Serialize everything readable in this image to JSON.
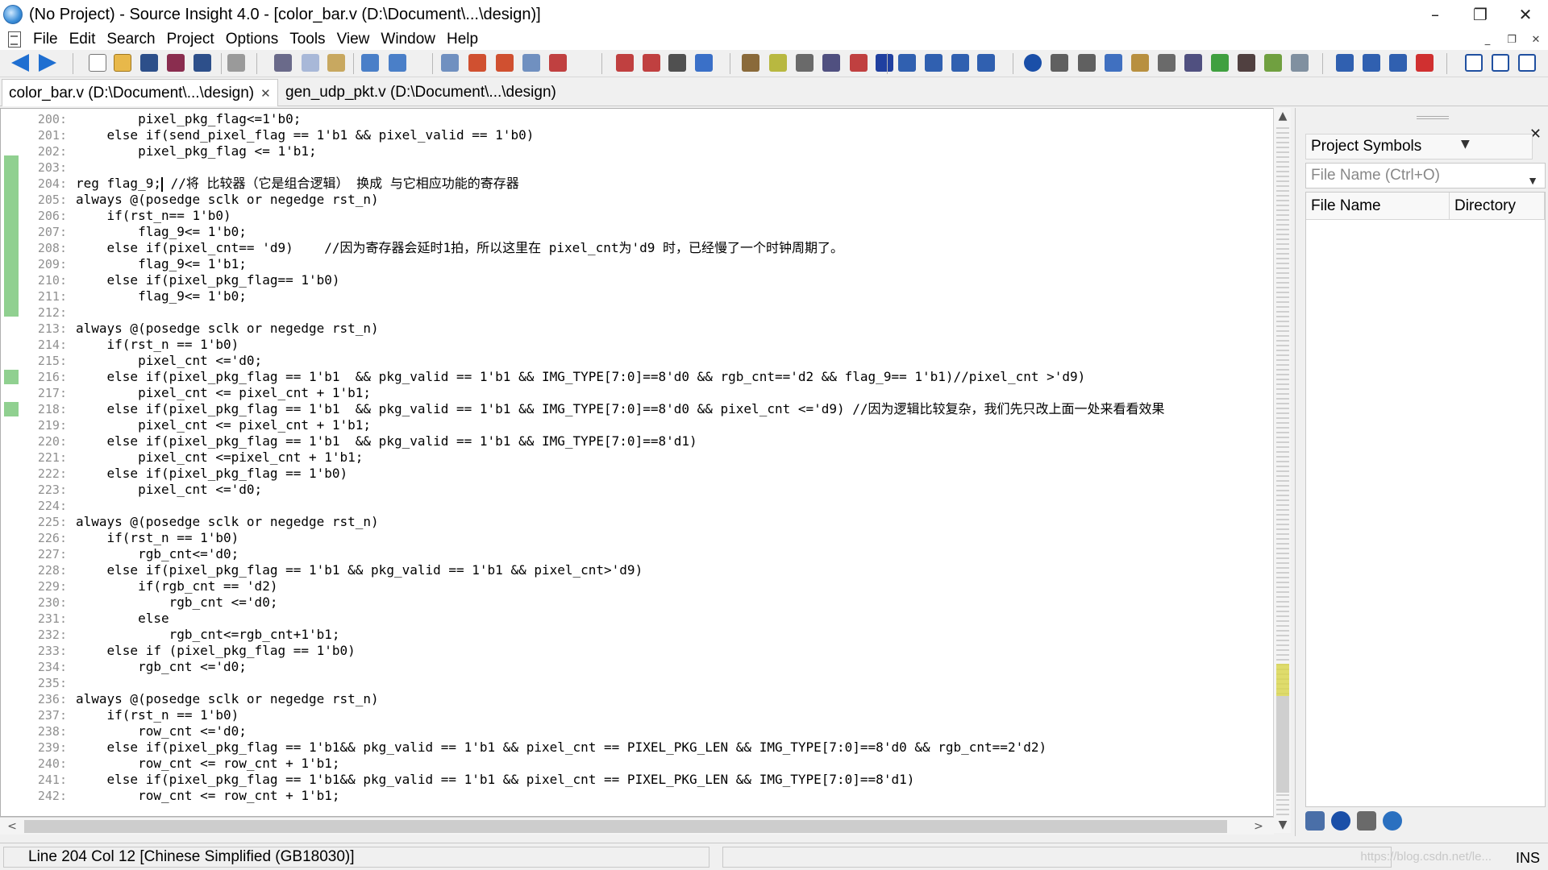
{
  "window": {
    "title": "(No Project) - Source Insight 4.0 - [color_bar.v (D:\\Document\\...\\design)]"
  },
  "menu": [
    "File",
    "Edit",
    "Search",
    "Project",
    "Options",
    "Tools",
    "View",
    "Window",
    "Help"
  ],
  "window_controls": {
    "minimize": "–",
    "restore": "❐",
    "close": "✕"
  },
  "mdi_controls": {
    "minimize": "_",
    "restore": "❐",
    "close": "✕"
  },
  "tabs": [
    {
      "label": "color_bar.v (D:\\Document\\...\\design)",
      "active": true,
      "close": "✕"
    },
    {
      "label": "gen_udp_pkt.v (D:\\Document\\...\\design)",
      "active": false
    }
  ],
  "editor": {
    "lines": [
      {
        "n": "200:",
        "code": "        pixel_pkg_flag<=1'b0;"
      },
      {
        "n": "201:",
        "code": "    else if(send_pixel_flag == 1'b1 && pixel_valid == 1'b0)"
      },
      {
        "n": "202:",
        "code": "        pixel_pkg_flag <= 1'b1;"
      },
      {
        "n": "203:",
        "code": ""
      },
      {
        "n": "204:",
        "code": "reg flag_9;",
        "after_caret": " //将 比较器（它是组合逻辑） 换成 与它相应功能的寄存器",
        "caret": true
      },
      {
        "n": "205:",
        "code": "always @(posedge sclk or negedge rst_n)"
      },
      {
        "n": "206:",
        "code": "    if(rst_n== 1'b0)"
      },
      {
        "n": "207:",
        "code": "        flag_9<= 1'b0;"
      },
      {
        "n": "208:",
        "code": "    else if(pixel_cnt== 'd9)    //因为寄存器会延时1拍，所以这里在 pixel_cnt为'd9 时，已经慢了一个时钟周期了。"
      },
      {
        "n": "209:",
        "code": "        flag_9<= 1'b1;"
      },
      {
        "n": "210:",
        "code": "    else if(pixel_pkg_flag== 1'b0)"
      },
      {
        "n": "211:",
        "code": "        flag_9<= 1'b0;"
      },
      {
        "n": "212:",
        "code": ""
      },
      {
        "n": "213:",
        "code": "always @(posedge sclk or negedge rst_n)"
      },
      {
        "n": "214:",
        "code": "    if(rst_n == 1'b0)"
      },
      {
        "n": "215:",
        "code": "        pixel_cnt <='d0;"
      },
      {
        "n": "216:",
        "code": "    else if(pixel_pkg_flag == 1'b1  && pkg_valid == 1'b1 && IMG_TYPE[7:0]==8'd0 && rgb_cnt=='d2 && flag_9== 1'b1)//pixel_cnt >'d9)"
      },
      {
        "n": "217:",
        "code": "        pixel_cnt <= pixel_cnt + 1'b1;"
      },
      {
        "n": "218:",
        "code": "    else if(pixel_pkg_flag == 1'b1  && pkg_valid == 1'b1 && IMG_TYPE[7:0]==8'd0 && pixel_cnt <='d9) //因为逻辑比较复杂，我们先只改上面一处来看看效果"
      },
      {
        "n": "219:",
        "code": "        pixel_cnt <= pixel_cnt + 1'b1;"
      },
      {
        "n": "220:",
        "code": "    else if(pixel_pkg_flag == 1'b1  && pkg_valid == 1'b1 && IMG_TYPE[7:0]==8'd1)"
      },
      {
        "n": "221:",
        "code": "        pixel_cnt <=pixel_cnt + 1'b1;"
      },
      {
        "n": "222:",
        "code": "    else if(pixel_pkg_flag == 1'b0)"
      },
      {
        "n": "223:",
        "code": "        pixel_cnt <='d0;"
      },
      {
        "n": "224:",
        "code": ""
      },
      {
        "n": "225:",
        "code": "always @(posedge sclk or negedge rst_n)"
      },
      {
        "n": "226:",
        "code": "    if(rst_n == 1'b0)"
      },
      {
        "n": "227:",
        "code": "        rgb_cnt<='d0;"
      },
      {
        "n": "228:",
        "code": "    else if(pixel_pkg_flag == 1'b1 && pkg_valid == 1'b1 && pixel_cnt>'d9)"
      },
      {
        "n": "229:",
        "code": "        if(rgb_cnt == 'd2)"
      },
      {
        "n": "230:",
        "code": "            rgb_cnt <='d0;"
      },
      {
        "n": "231:",
        "code": "        else"
      },
      {
        "n": "232:",
        "code": "            rgb_cnt<=rgb_cnt+1'b1;"
      },
      {
        "n": "233:",
        "code": "    else if (pixel_pkg_flag == 1'b0)"
      },
      {
        "n": "234:",
        "code": "        rgb_cnt <='d0;"
      },
      {
        "n": "235:",
        "code": ""
      },
      {
        "n": "236:",
        "code": "always @(posedge sclk or negedge rst_n)"
      },
      {
        "n": "237:",
        "code": "    if(rst_n == 1'b0)"
      },
      {
        "n": "238:",
        "code": "        row_cnt <='d0;"
      },
      {
        "n": "239:",
        "code": "    else if(pixel_pkg_flag == 1'b1&& pkg_valid == 1'b1 && pixel_cnt == PIXEL_PKG_LEN && IMG_TYPE[7:0]==8'd0 && rgb_cnt==2'd2)"
      },
      {
        "n": "240:",
        "code": "        row_cnt <= row_cnt + 1'b1;"
      },
      {
        "n": "241:",
        "code": "    else if(pixel_pkg_flag == 1'b1&& pkg_valid == 1'b1 && pixel_cnt == PIXEL_PKG_LEN && IMG_TYPE[7:0]==8'd1)"
      },
      {
        "n": "242:",
        "code": "        row_cnt <= row_cnt + 1'b1;"
      }
    ]
  },
  "scroll": {
    "up": "▲",
    "down": "▼",
    "left": "<",
    "right": ">"
  },
  "side_panel": {
    "title": "Project Symbols",
    "close": "✕",
    "dropdown_chevron": "▼",
    "input_placeholder": "File Name (Ctrl+O)",
    "columns": [
      "File Name",
      "Directory"
    ]
  },
  "status_bar": {
    "position": "Line 204  Col 12   [Chinese Simplified (GB18030)]",
    "watermark": "https://blog.csdn.net/le...",
    "mode": "INS"
  },
  "colors": {
    "accent_blue": "#1f6fd1",
    "changed_line_marker": "#90d090",
    "overview_highlight": "#d9d64a"
  }
}
